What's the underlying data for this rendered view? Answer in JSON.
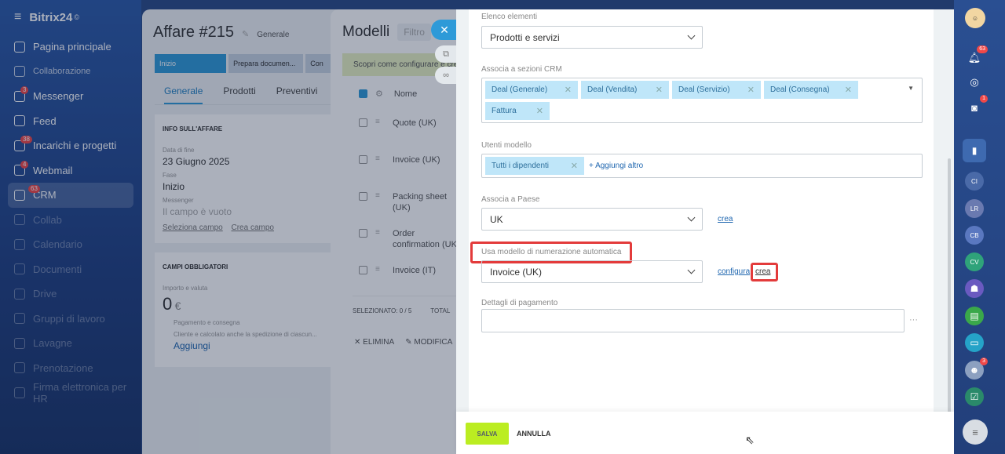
{
  "brand": "Bitrix24",
  "brand_mark": "©",
  "sidebar": {
    "items": [
      {
        "label": "Pagina principale",
        "icon": "home-icon",
        "count": ""
      },
      {
        "label": "Collaborazione",
        "icon": "collab-icon",
        "count": ""
      },
      {
        "label": "Messenger",
        "icon": "chat-icon",
        "count": "3"
      },
      {
        "label": "Feed",
        "icon": "feed-icon",
        "count": ""
      },
      {
        "label": "Incarichi e progetti",
        "icon": "tasks-icon",
        "count": "38"
      },
      {
        "label": "Webmail",
        "icon": "mail-icon",
        "count": "4"
      },
      {
        "label": "CRM",
        "icon": "crm-icon",
        "count": "63"
      },
      {
        "label": "Collab",
        "icon": "collab-round-icon",
        "count": ""
      },
      {
        "label": "Calendario",
        "icon": "calendar-icon",
        "count": ""
      },
      {
        "label": "Documenti",
        "icon": "documents-icon",
        "count": ""
      },
      {
        "label": "Drive",
        "icon": "drive-icon",
        "count": ""
      },
      {
        "label": "Gruppi di lavoro",
        "icon": "groups-icon",
        "count": ""
      },
      {
        "label": "Lavagne",
        "icon": "boards-icon",
        "count": ""
      },
      {
        "label": "Prenotazione",
        "icon": "booking-icon",
        "count": ""
      },
      {
        "label": "Firma elettronica per HR",
        "icon": "signature-icon",
        "count": ""
      }
    ]
  },
  "deal": {
    "title": "Affare #215",
    "category": "Generale",
    "stages": [
      "Inizio",
      "Prepara documen...",
      "Con"
    ],
    "tabs": [
      "Generale",
      "Prodotti",
      "Preventivi"
    ],
    "section_info": "INFO SULL'AFFARE",
    "end_date_label": "Data di fine",
    "end_date": "23 Giugno 2025",
    "stage_label": "Fase",
    "stage": "Inizio",
    "messenger_label": "Messenger",
    "messenger_value": "Il campo è vuoto",
    "select_field": "Seleziona campo",
    "create_field": "Crea campo",
    "required_section": "CAMPI OBBLIGATORI",
    "amount_label": "Importo e valuta",
    "amount": "0",
    "currency": "€",
    "note1": "Pagamento e consegna",
    "note2": "Cliente e calcolato anche la spedizione di ciascun...",
    "add": "Aggiungi"
  },
  "models": {
    "title": "Modelli",
    "filter_placeholder": "Filtro",
    "info": "Scopri come configurare e cre",
    "col_name": "Nome",
    "rows": [
      "Quote (UK)",
      "Invoice (UK)",
      "Packing sheet (UK)",
      "Order confirmation (UK)",
      "Invoice (IT)"
    ],
    "selected": "SELEZIONATO: 0 / 5",
    "total": "TOTAL",
    "delete": "ELIMINA",
    "edit": "MODIFICA"
  },
  "form": {
    "elements_label": "Elenco elementi",
    "elements_value": "Prodotti e servizi",
    "crm_sections_label": "Associa a sezioni CRM",
    "crm_tags": [
      "Deal (Generale)",
      "Deal (Vendita)",
      "Deal (Servizio)",
      "Deal (Consegna)",
      "Fattura"
    ],
    "users_label": "Utenti modello",
    "users_tag": "Tutti i dipendenti",
    "add_more": "+ Aggiungi altro",
    "country_label": "Associa a Paese",
    "country_value": "UK",
    "country_create": "crea",
    "numbering_label": "Usa modello di numerazione automatica",
    "numbering_value": "Invoice (UK)",
    "numbering_configure": "configura",
    "numbering_create": "crea",
    "payment_label": "Dettagli di pagamento",
    "payment_value": "",
    "more": "···",
    "save": "SALVA",
    "cancel": "ANNULLA"
  },
  "right_sidebar": {
    "notifications_count": "63",
    "chat_count": "1",
    "avatars": [
      "CI",
      "LR",
      "CB",
      "CV"
    ],
    "bottom_count": "3"
  },
  "colors": {
    "accent": "#2e9ad8",
    "save": "#bbed21",
    "highlight": "#e33b3b",
    "tag_bg": "#bfe6f9"
  }
}
